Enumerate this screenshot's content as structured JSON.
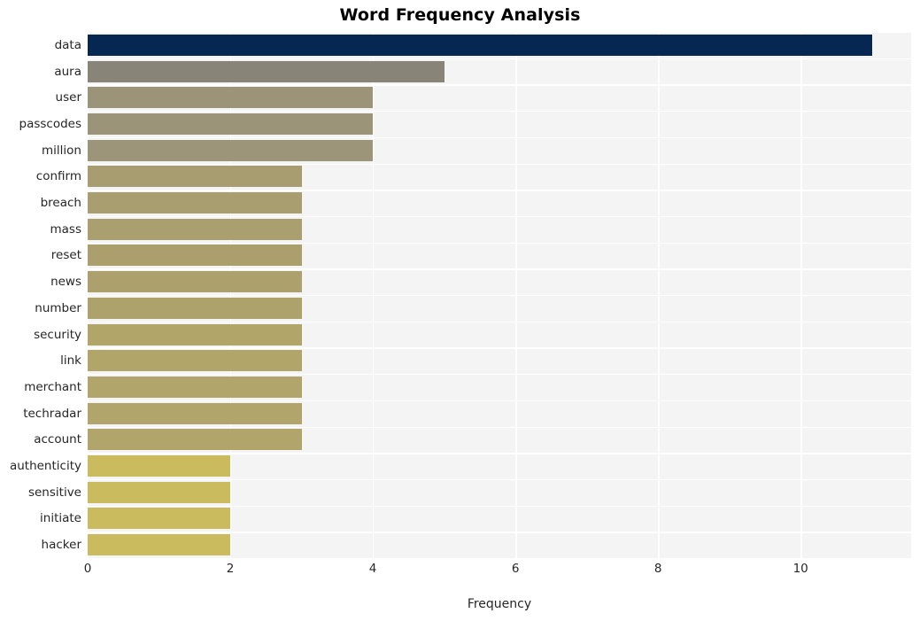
{
  "chart_data": {
    "type": "bar",
    "orientation": "horizontal",
    "title": "Word Frequency Analysis",
    "xlabel": "Frequency",
    "ylabel": "",
    "categories": [
      "data",
      "aura",
      "user",
      "passcodes",
      "million",
      "confirm",
      "breach",
      "mass",
      "reset",
      "news",
      "number",
      "security",
      "link",
      "merchant",
      "techradar",
      "account",
      "authenticity",
      "sensitive",
      "initiate",
      "hacker"
    ],
    "values": [
      11,
      5,
      4,
      4,
      4,
      3,
      3,
      3,
      3,
      3,
      3,
      3,
      3,
      3,
      3,
      3,
      2,
      2,
      2,
      2
    ],
    "bar_colors": [
      "#062751",
      "#888578",
      "#9c9479",
      "#9c9479",
      "#9d9579",
      "#a89d70",
      "#a99e70",
      "#aa9f6e",
      "#ab9f6e",
      "#ac a06d",
      "#aea26c",
      "#b2a56a",
      "#b1a56a",
      "#b1a56b",
      "#b1a56b",
      "#b1a56b",
      "#cbbb5f",
      "#cbbb5f",
      "#cbbb5f",
      "#cbbb5f"
    ],
    "xlim": [
      0,
      11.55
    ],
    "xticks": [
      0,
      2,
      4,
      6,
      8,
      10
    ],
    "xtick_labels": [
      "0",
      "2",
      "4",
      "6",
      "8",
      "10"
    ],
    "grid": true,
    "grid_color": "#ffffff",
    "plot_background": "#f4f4f5",
    "figure_background": "#ffffff",
    "legend": null
  }
}
